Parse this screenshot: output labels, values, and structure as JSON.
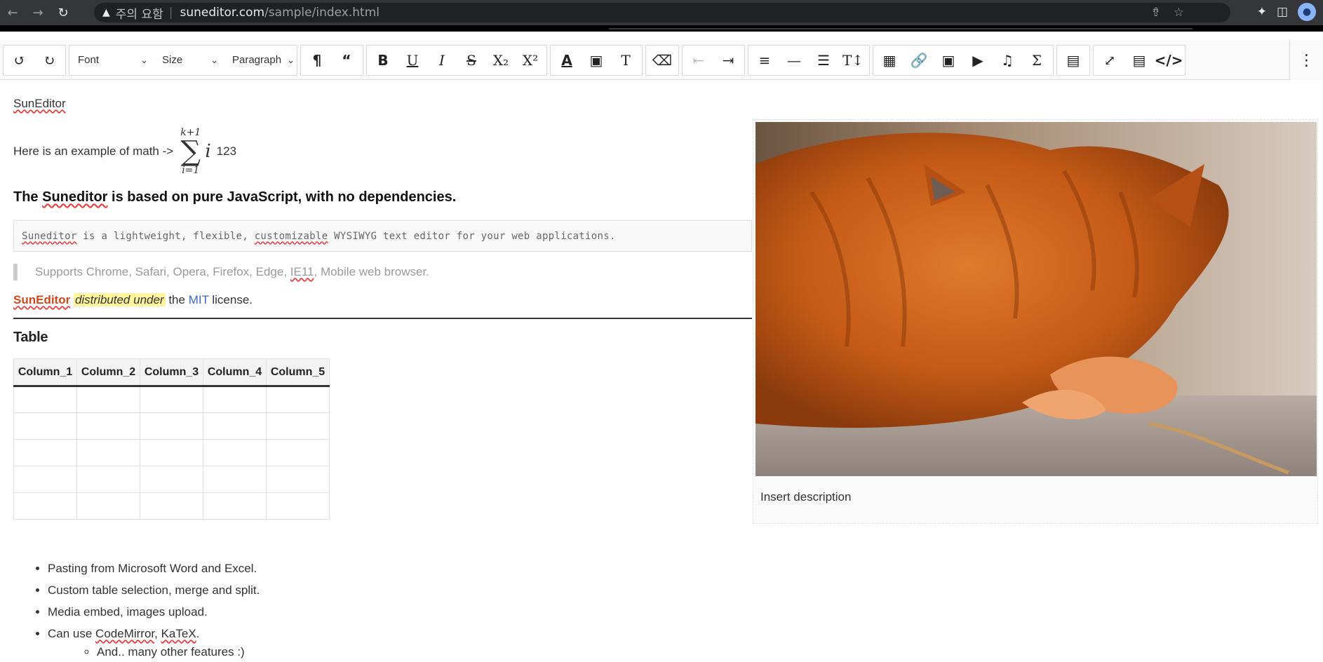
{
  "browser": {
    "warning_text": "주의 요함",
    "separator": "|",
    "url_host": "suneditor.com",
    "url_path": "/sample/index.html"
  },
  "toolbar": {
    "font_label": "Font",
    "size_label": "Size",
    "format_label": "Paragraph"
  },
  "content": {
    "title_link": "SunEditor",
    "math_prefix": "Here is an example of math ->",
    "math_sup": "k+1",
    "math_sigma": "∑",
    "math_sub": "i=1",
    "math_var": "i",
    "math_suffix": "123",
    "heading_pre": "The ",
    "heading_link": "Suneditor",
    "heading_post": " is based on pure JavaScript, with no dependencies.",
    "pre_w1": "Suneditor",
    "pre_t1": " is a lightweight, flexible, ",
    "pre_w2": "customizable",
    "pre_t2": " WYSIWYG text editor for your web applications.",
    "quote_pre": "Supports Chrome, Safari, Opera, Firefox, Edge, ",
    "quote_ie": "IE11",
    "quote_post": ", Mobile web browser.",
    "lic_sun": "SunEditor",
    "lic_hl": "distributed under",
    "lic_the": " the ",
    "lic_mit": "MIT",
    "lic_end": " license.",
    "table_title": "Table",
    "table_headers": [
      "Column_1",
      "Column_2",
      "Column_3",
      "Column_4",
      "Column_5"
    ],
    "image_caption": "Insert description",
    "list_items": [
      "Pasting from Microsoft Word and Excel.",
      "Custom table selection, merge and split.",
      "Media embed, images upload."
    ],
    "list_last_pre": "Can use ",
    "list_last_cm": "CodeMirror",
    "list_last_sep": ", ",
    "list_last_katex": "KaTeX",
    "list_last_end": ".",
    "sub_item": "And.. many other features :)"
  },
  "colors": {
    "accent_orange": "#d4471a",
    "highlight_yellow": "#fff59d",
    "link_blue": "#3a66c4"
  }
}
